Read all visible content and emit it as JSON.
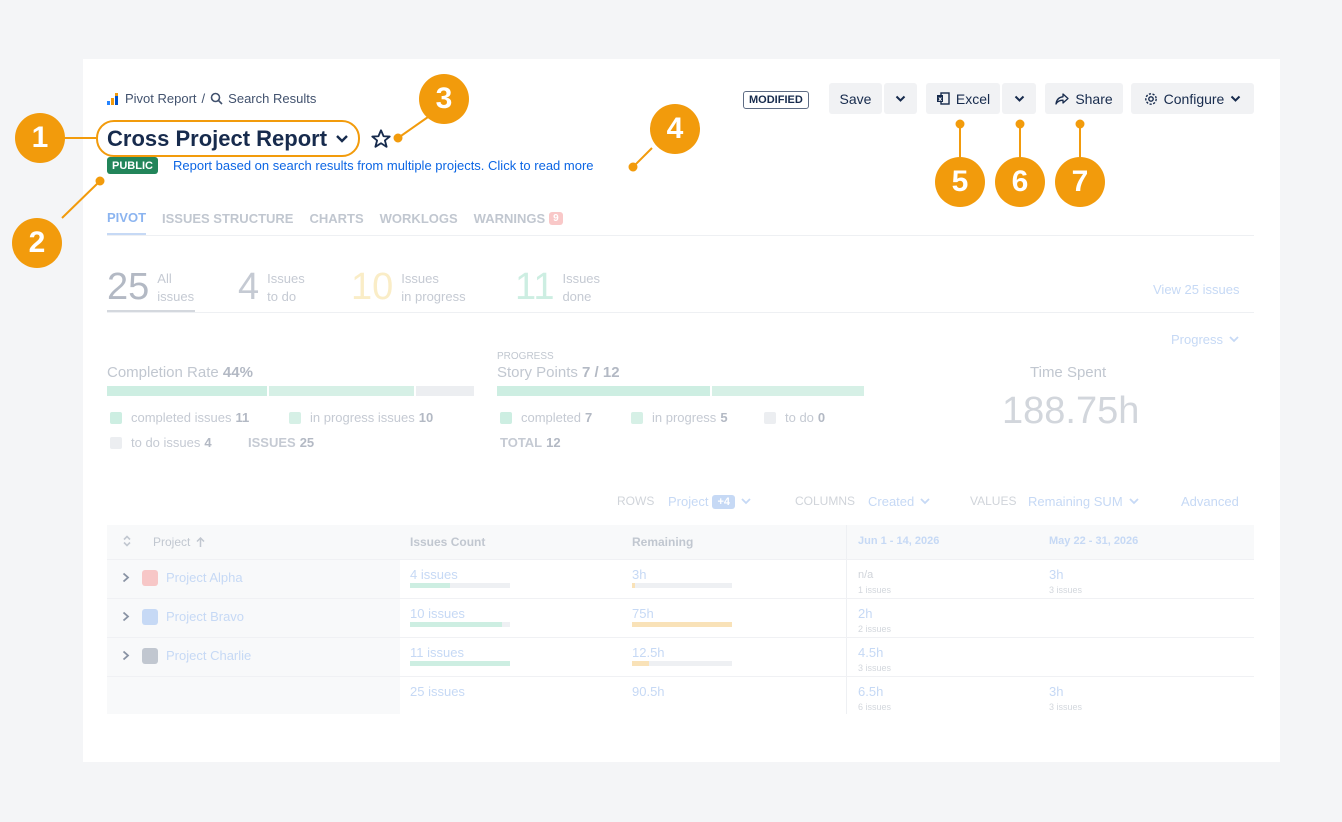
{
  "breadcrumb": {
    "root": "Pivot Report",
    "separator": "/",
    "current": "Search Results"
  },
  "report": {
    "title": "Cross Project Report",
    "visibility": "PUBLIC",
    "description": "Report based on search results from multiple projects. Click to read more"
  },
  "toolbar": {
    "status": "MODIFIED",
    "save": "Save",
    "excel": "Excel",
    "share": "Share",
    "configure": "Configure"
  },
  "tabs": [
    {
      "label": "PIVOT"
    },
    {
      "label": "ISSUES STRUCTURE"
    },
    {
      "label": "CHARTS"
    },
    {
      "label": "WORKLOGS"
    },
    {
      "label": "WARNINGS",
      "count": "9"
    }
  ],
  "stats": [
    {
      "value": "25",
      "line1": "All",
      "line2": "issues",
      "color": "#b3b9c4"
    },
    {
      "value": "4",
      "line1": "Issues",
      "line2": "to do",
      "color": "#c5cad3"
    },
    {
      "value": "10",
      "line1": "Issues",
      "line2": "in progress",
      "color": "#faedc7"
    },
    {
      "value": "11",
      "line1": "Issues",
      "line2": "done",
      "color": "#cdeee2"
    }
  ],
  "view_issues": "View 25 issues",
  "progress_dropdown": "Progress",
  "completion": {
    "title": "Completion Rate",
    "percent": "44%",
    "fractions": {
      "completed": 0.44,
      "in_progress": 0.4,
      "todo": 0.16
    },
    "legend": {
      "completed": "completed issues",
      "completed_n": "11",
      "in_progress": "in progress issues",
      "in_progress_n": "10",
      "todo": "to do issues",
      "todo_n": "4",
      "issues": "ISSUES",
      "issues_n": "25"
    }
  },
  "story_points": {
    "caption": "PROGRESS",
    "title": "Story Points",
    "value": "7 / 12",
    "fractions": {
      "completed": 0.583,
      "in_progress": 0.417
    },
    "legend": {
      "completed": "completed",
      "completed_n": "7",
      "in_progress": "in progress",
      "in_progress_n": "5",
      "todo": "to do",
      "todo_n": "0",
      "total": "TOTAL",
      "total_n": "12"
    }
  },
  "time_spent": {
    "title": "Time Spent",
    "value": "188.75h"
  },
  "pivot_config": {
    "rows_label": "ROWS",
    "rows_value": "Project",
    "rows_extra": "+4",
    "columns_label": "COLUMNS",
    "columns_value": "Created",
    "values_label": "VALUES",
    "values_value": "Remaining SUM",
    "advanced": "Advanced"
  },
  "table": {
    "headers": {
      "project": "Project",
      "count": "Issues Count",
      "remaining": "Remaining",
      "date1": "Jun 1 - 14, 2026",
      "date2": "May 22 - 31, 2026"
    },
    "rows": [
      {
        "project": "Project Alpha",
        "count": "4 issues",
        "count_frac": 0.4,
        "remaining": "3h",
        "remaining_frac": 0.03,
        "d1": "n/a",
        "d1_sub": "1 issues",
        "d2": "3h",
        "d2_sub": "3 issues"
      },
      {
        "project": "Project Bravo",
        "count": "10 issues",
        "count_frac": 0.92,
        "remaining": "75h",
        "remaining_frac": 1.0,
        "d1": "2h",
        "d1_sub": "2 issues",
        "d2": "",
        "d2_sub": ""
      },
      {
        "project": "Project Charlie",
        "count": "11 issues",
        "count_frac": 1.0,
        "remaining": "12.5h",
        "remaining_frac": 0.17,
        "d1": "4.5h",
        "d1_sub": "3 issues",
        "d2": "",
        "d2_sub": ""
      }
    ],
    "totals": {
      "count": "25 issues",
      "remaining": "90.5h",
      "d1": "6.5h",
      "d1_sub": "6 issues",
      "d2": "3h",
      "d2_sub": "3 issues"
    }
  },
  "callouts": [
    "1",
    "2",
    "3",
    "4",
    "5",
    "6",
    "7"
  ],
  "colors": {
    "accent": "#f29b0c",
    "public_badge": "#22855a",
    "link": "#0c66e4",
    "completed": "#cdeee2",
    "in_progress": "#f9e2b8",
    "todo": "#eceef1"
  }
}
